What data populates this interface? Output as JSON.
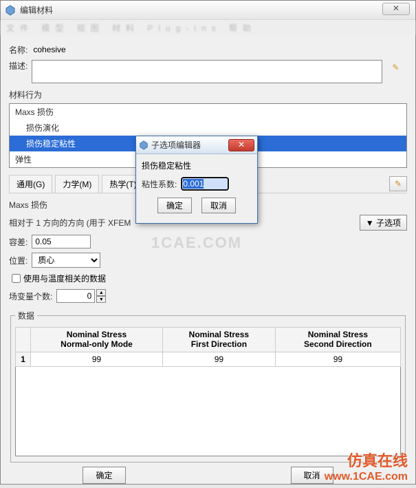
{
  "window": {
    "title": "编辑材料",
    "close_glyph": "✕"
  },
  "fields": {
    "name_label": "名称:",
    "name_value": "cohesive",
    "desc_label": "描述:",
    "desc_value": ""
  },
  "behavior": {
    "section_label": "材料行为",
    "items": [
      {
        "label": "Maxs 损伤",
        "indent": 0,
        "selected": false
      },
      {
        "label": "损伤演化",
        "indent": 1,
        "selected": false
      },
      {
        "label": "损伤稳定粘性",
        "indent": 1,
        "selected": true
      },
      {
        "label": "弹性",
        "indent": 0,
        "selected": false
      }
    ]
  },
  "tabs": {
    "general": "通用(G)",
    "mechanical": "力学(M)",
    "thermal": "热学(T)"
  },
  "panel": {
    "heading": "Maxs 损伤",
    "direction_label": "相对于 1 方向的方向 (用于 XFEM",
    "suboption_btn": "子选项",
    "tolerance_label": "容差:",
    "tolerance_value": "0.05",
    "position_label": "位置:",
    "position_value": "质心",
    "temp_checkbox_label": "使用与温度相关的数据",
    "fieldvar_label": "场变量个数:",
    "fieldvar_value": "0"
  },
  "data": {
    "legend": "数据",
    "headers": [
      "Nominal Stress\nNormal-only Mode",
      "Nominal Stress\nFirst Direction",
      "Nominal Stress\nSecond Direction"
    ],
    "rows": [
      {
        "n": "1",
        "cells": [
          "99",
          "99",
          "99"
        ]
      }
    ]
  },
  "footer": {
    "ok": "确定",
    "cancel": "取消"
  },
  "subdialog": {
    "title": "子选项编辑器",
    "heading": "损伤稳定粘性",
    "coef_label": "粘性系数:",
    "coef_value": "0.001",
    "ok": "确定",
    "cancel": "取消",
    "close_glyph": "✕"
  },
  "watermark": {
    "logo": "仿真在线",
    "url": "www.1CAE.com",
    "mid": "1CAE.COM"
  }
}
